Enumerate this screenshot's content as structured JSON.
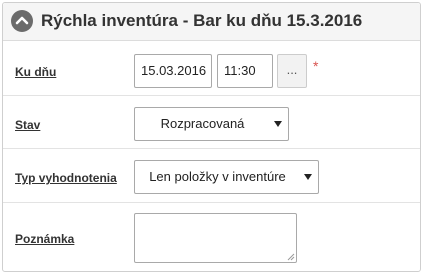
{
  "panel": {
    "title": "Rýchla inventúra - Bar ku dňu 15.3.2016",
    "collapse_icon": "chevron-up-icon"
  },
  "fields": {
    "ku_dnu": {
      "label": "Ku dňu",
      "date_value": "15.03.2016",
      "time_value": "11:30",
      "picker_label": "...",
      "required_mark": "*"
    },
    "stav": {
      "label": "Stav",
      "selected": "Rozpracovaná"
    },
    "typ_vyhodnotenia": {
      "label": "Typ vyhodnotenia",
      "selected": "Len položky v inventúre"
    },
    "poznamka": {
      "label": "Poznámka",
      "value": ""
    }
  },
  "colors": {
    "required": "#d9534f",
    "header_bg": "#f5f5f5",
    "collapse_btn": "#6b6b6b"
  }
}
